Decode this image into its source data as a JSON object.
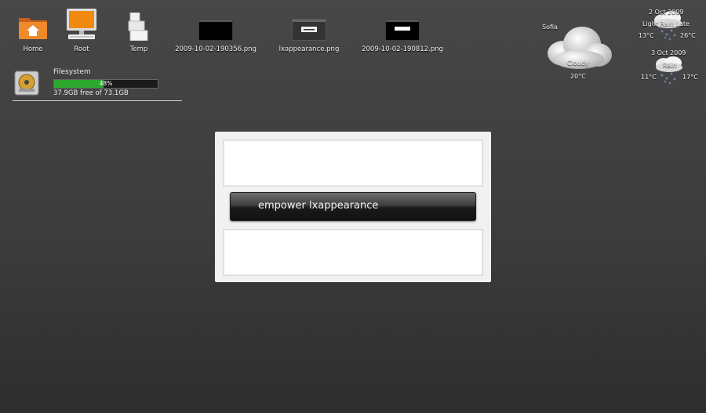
{
  "desktop": {
    "icons": [
      {
        "label": "Home",
        "icon": "home-folder-icon"
      },
      {
        "label": "Root",
        "icon": "computer-icon"
      },
      {
        "label": "Temp",
        "icon": "boxes-icon"
      },
      {
        "label": "2009-10-02-190356.png",
        "icon": "image-thumbnail-icon"
      },
      {
        "label": "lxappearance.png",
        "icon": "image-thumbnail-icon"
      },
      {
        "label": "2009-10-02-190812.png",
        "icon": "image-thumbnail-icon"
      }
    ]
  },
  "filesystem": {
    "title": "Filesystem",
    "usage_percent": 48,
    "usage_label": "48%",
    "free_text": "37.9GB free of 73.1GB"
  },
  "weather": {
    "current": {
      "city": "Sofia",
      "condition": "Cloudy",
      "temp": "20°C"
    },
    "forecast": [
      {
        "date": "2 Oct 2009",
        "condition": "Light Rain Late",
        "low": "13°C",
        "high": "26°C"
      },
      {
        "date": "3 Oct 2009",
        "condition": "Rain",
        "low": "11°C",
        "high": "17°C"
      }
    ]
  },
  "dialog": {
    "button_label": "empower lxappearance"
  },
  "colors": {
    "usage_bar": "#2ca82c",
    "folder_orange": "#e8781e",
    "desktop_bg": "#404040"
  }
}
